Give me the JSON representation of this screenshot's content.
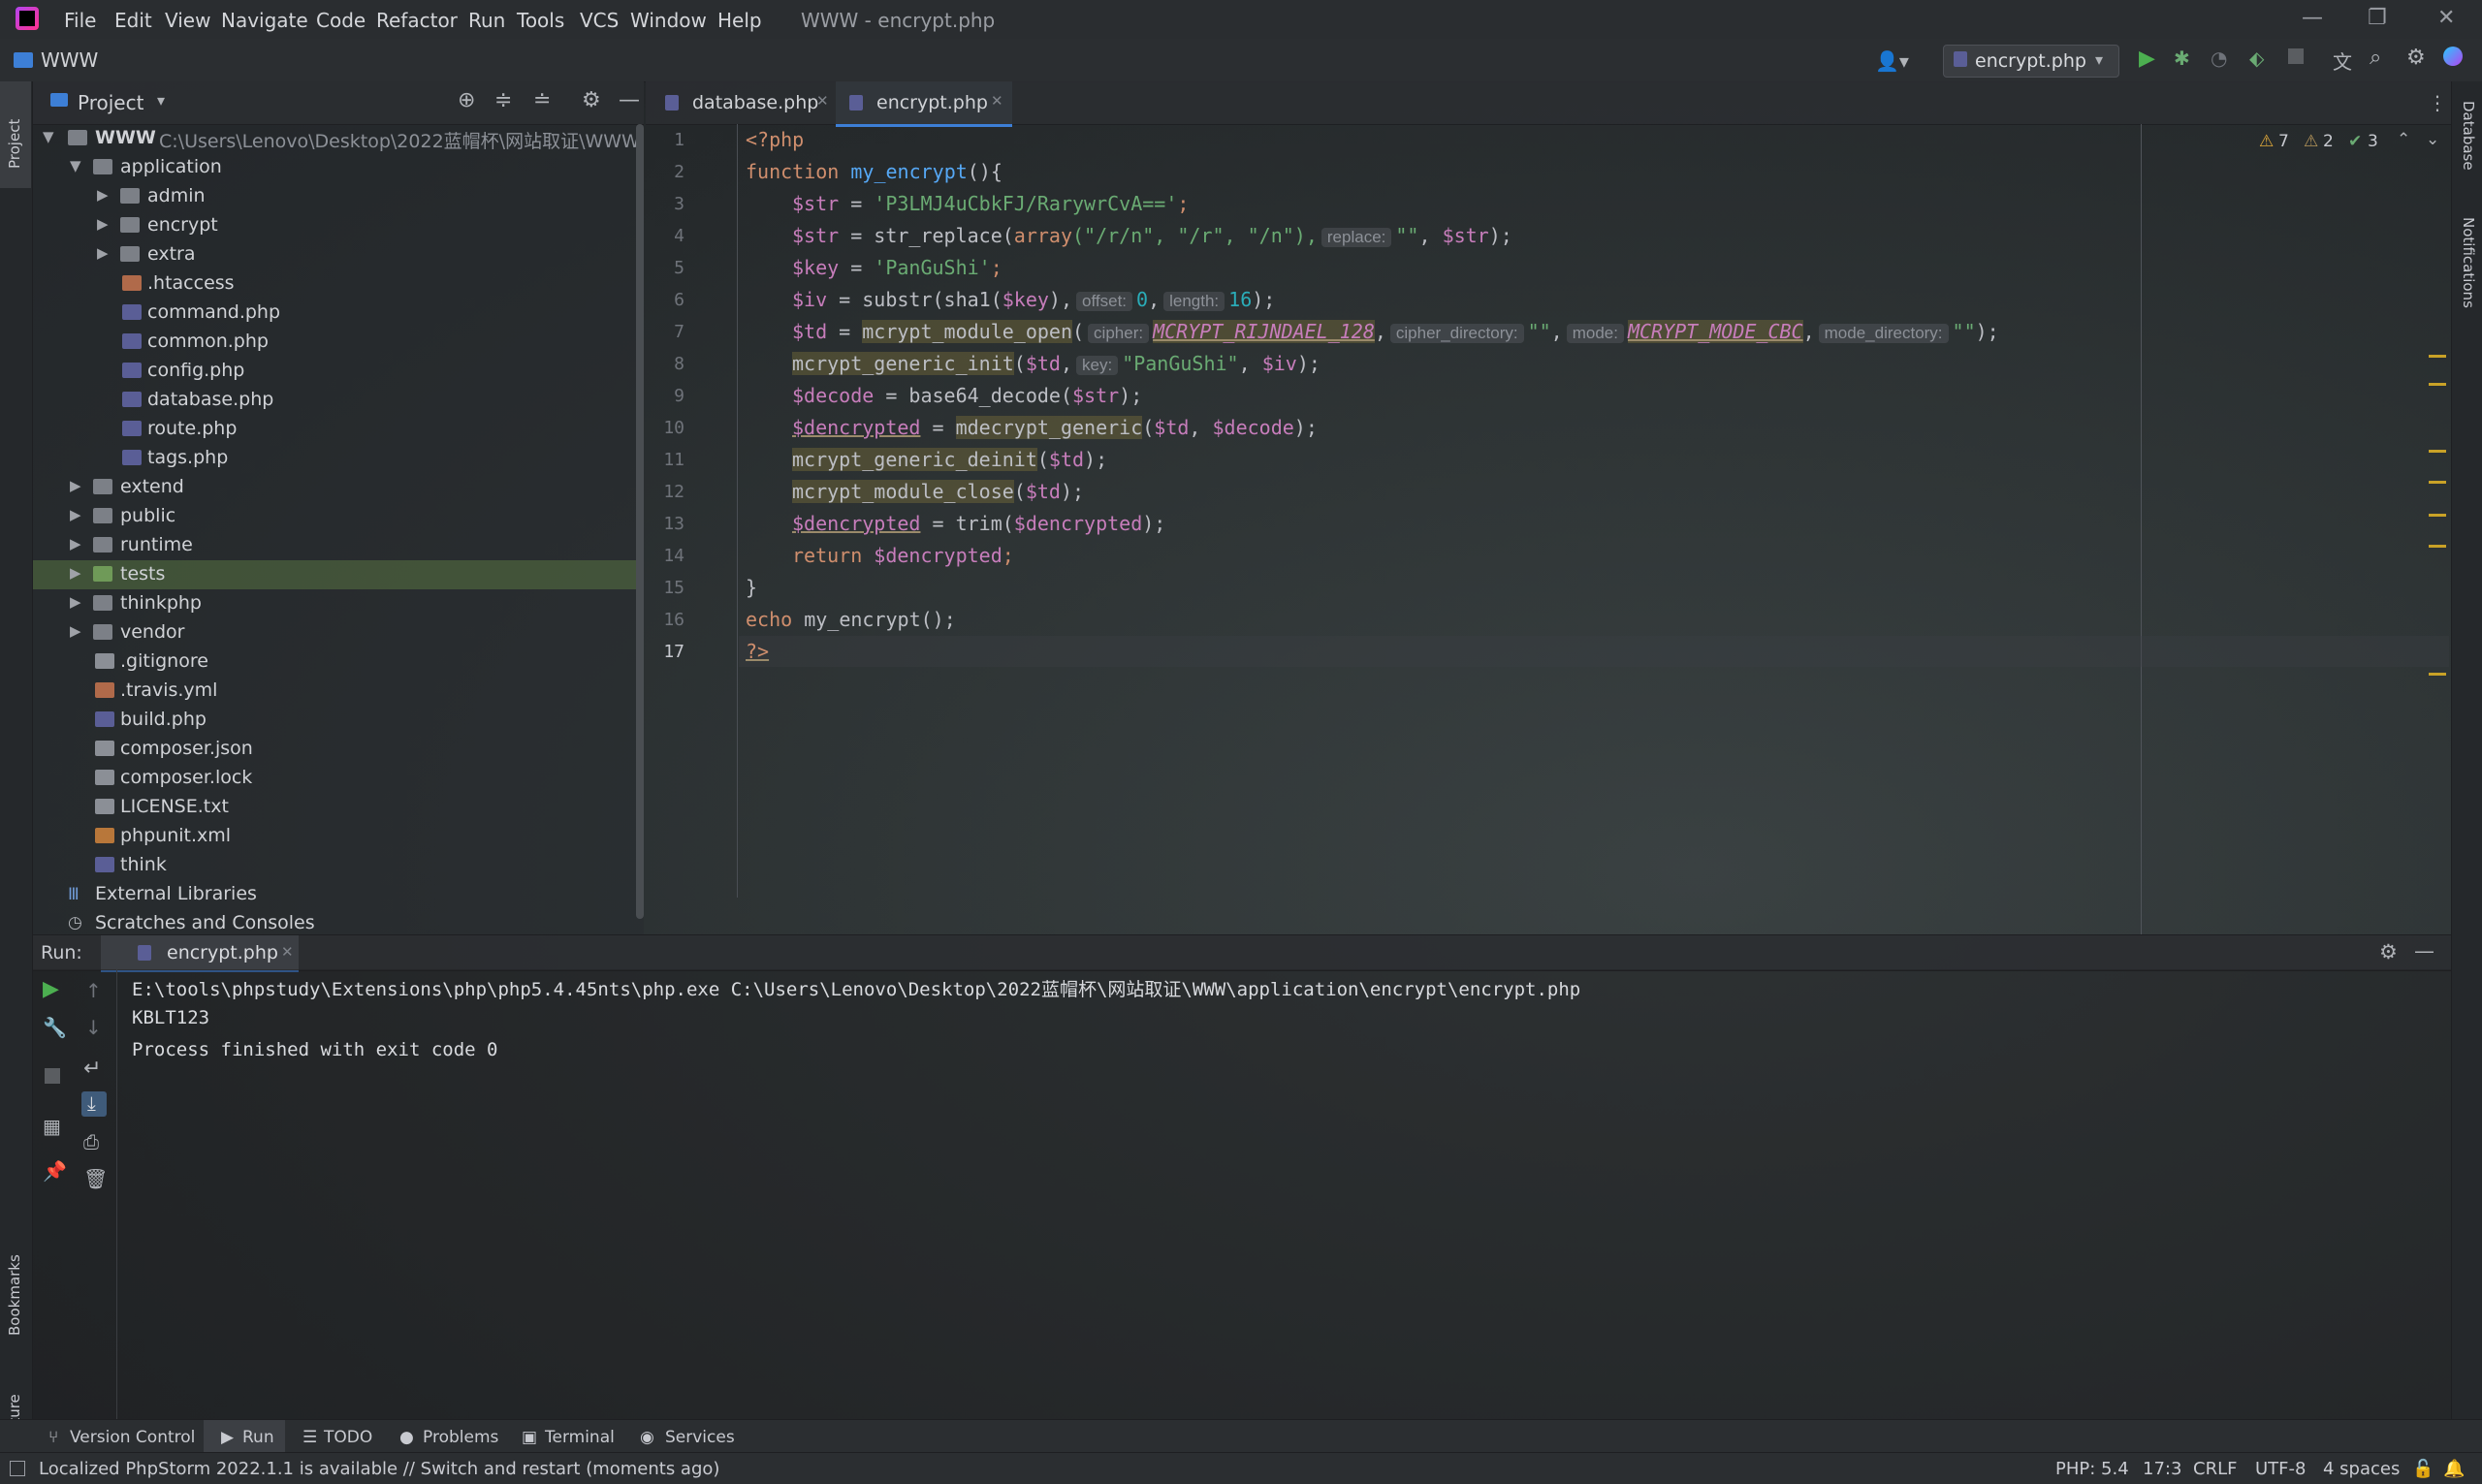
{
  "window": {
    "title": "WWW - encrypt.php"
  },
  "menu": [
    "File",
    "Edit",
    "View",
    "Navigate",
    "Code",
    "Refactor",
    "Run",
    "Tools",
    "VCS",
    "Window",
    "Help"
  ],
  "navbar": {
    "project": "WWW",
    "run_config": "encrypt.php"
  },
  "left_strip": {
    "project": "Project",
    "bookmarks": "Bookmarks",
    "structure": "Structure"
  },
  "right_strip": {
    "database": "Database",
    "notifications": "Notifications"
  },
  "project_panel": {
    "title": "Project",
    "tree": [
      {
        "label": "WWW",
        "path": "C:\\Users\\Lenovo\\Desktop\\2022蓝帽杯\\网站取证\\WWW"
      },
      {
        "label": "application"
      },
      {
        "label": "admin"
      },
      {
        "label": "encrypt"
      },
      {
        "label": "extra"
      },
      {
        "label": ".htaccess"
      },
      {
        "label": "command.php"
      },
      {
        "label": "common.php"
      },
      {
        "label": "config.php"
      },
      {
        "label": "database.php"
      },
      {
        "label": "route.php"
      },
      {
        "label": "tags.php"
      },
      {
        "label": "extend"
      },
      {
        "label": "public"
      },
      {
        "label": "runtime"
      },
      {
        "label": "tests"
      },
      {
        "label": "thinkphp"
      },
      {
        "label": "vendor"
      },
      {
        "label": ".gitignore"
      },
      {
        "label": ".travis.yml"
      },
      {
        "label": "build.php"
      },
      {
        "label": "composer.json"
      },
      {
        "label": "composer.lock"
      },
      {
        "label": "LICENSE.txt"
      },
      {
        "label": "phpunit.xml"
      },
      {
        "label": "think"
      },
      {
        "label": "External Libraries"
      },
      {
        "label": "Scratches and Consoles"
      }
    ]
  },
  "editor": {
    "tabs": [
      "database.php",
      "encrypt.php"
    ],
    "inspections": {
      "warnings": "7",
      "weak_warnings": "2",
      "ok": "3"
    },
    "line_numbers": [
      "1",
      "2",
      "3",
      "4",
      "5",
      "6",
      "7",
      "8",
      "9",
      "10",
      "11",
      "12",
      "13",
      "14",
      "15",
      "16",
      "17"
    ],
    "code": {
      "l1": "<?php",
      "l2_kw": "function ",
      "l2_fn": "my_encrypt",
      "l2_rest": "(){",
      "l3_var": "$str",
      "l3_eq": " = ",
      "l3_str": "'P3LMJ4uCbkFJ/RarywrCvA=='",
      "l3_end": ";",
      "l4_var": "$str",
      "l4_eq": " = str_replace(",
      "l4_kw": "array",
      "l4_args": "(\"/r/n\", \"/r\", \"/n\"),",
      "l4_hint": "replace:",
      "l4_str": "\"\"",
      "l4_end": ", ",
      "l4_var2": "$str",
      "l4_close": ");",
      "l5_var": "$key",
      "l5_eq": " = ",
      "l5_str": "'PanGuShi'",
      "l5_end": ";",
      "l6_var": "$iv",
      "l6_eq": " = substr(sha1(",
      "l6_var2": "$key",
      "l6_mid": "),",
      "l6_hint1": "offset:",
      "l6_num1": "0",
      "l6_sep": ",",
      "l6_hint2": "length:",
      "l6_num2": "16",
      "l6_end": ");",
      "l7_var": "$td",
      "l7_eq": " = ",
      "l7_fn": "mcrypt_module_open",
      "l7_open": "(",
      "l7_hint1": "cipher:",
      "l7_c1": "MCRYPT_RIJNDAEL_128",
      "l7_sep1": ",",
      "l7_hint2": "cipher_directory:",
      "l7_s1": "\"\"",
      "l7_sep2": ",",
      "l7_hint3": "mode:",
      "l7_c2": "MCRYPT_MODE_CBC",
      "l7_sep3": ",",
      "l7_hint4": "mode_directory:",
      "l7_s2": "\"\"",
      "l7_end": ");",
      "l8_fn": "mcrypt_generic_init",
      "l8_open": "(",
      "l8_var": "$td",
      "l8_sep": ",",
      "l8_hint": "key:",
      "l8_str": "\"PanGuShi\"",
      "l8_sep2": ", ",
      "l8_var2": "$iv",
      "l8_end": ");",
      "l9_var": "$decode",
      "l9_eq": " = base64_decode(",
      "l9_var2": "$str",
      "l9_end": ");",
      "l10_var": "$dencrypted",
      "l10_eq": " = ",
      "l10_fn": "mdecrypt_generic",
      "l10_open": "(",
      "l10_var2": "$td",
      "l10_sep": ", ",
      "l10_var3": "$decode",
      "l10_end": ");",
      "l11_fn": "mcrypt_generic_deinit",
      "l11_open": "(",
      "l11_var": "$td",
      "l11_end": ");",
      "l12_fn": "mcrypt_module_close",
      "l12_open": "(",
      "l12_var": "$td",
      "l12_end": ");",
      "l13_var": "$dencrypted",
      "l13_eq": " = trim(",
      "l13_var2": "$dencrypted",
      "l13_end": ");",
      "l14_kw": "return ",
      "l14_var": "$dencrypted",
      "l14_end": ";",
      "l15": "}",
      "l16_kw": "echo ",
      "l16_rest": "my_encrypt();",
      "l17": "?>"
    }
  },
  "run_panel": {
    "label": "Run:",
    "tab": "encrypt.php",
    "output": [
      "E:\\tools\\phpstudy\\Extensions\\php\\php5.4.45nts\\php.exe C:\\Users\\Lenovo\\Desktop\\2022蓝帽杯\\网站取证\\WWW\\application\\encrypt\\encrypt.php",
      "KBLT123",
      "Process finished with exit code 0"
    ]
  },
  "bottom_tools": [
    "Version Control",
    "Run",
    "TODO",
    "Problems",
    "Terminal",
    "Services"
  ],
  "status": {
    "message": "Localized PhpStorm 2022.1.1 is available // Switch and restart (moments ago)",
    "php": "PHP: 5.4",
    "position": "17:3",
    "line_sep": "CRLF",
    "encoding": "UTF-8",
    "indent": "4 spaces"
  },
  "colors": {
    "accent": "#3d7fd6",
    "keyword": "#cf8e6d",
    "string": "#6aab73",
    "variable": "#c77dbb",
    "run": "#4caf50"
  }
}
